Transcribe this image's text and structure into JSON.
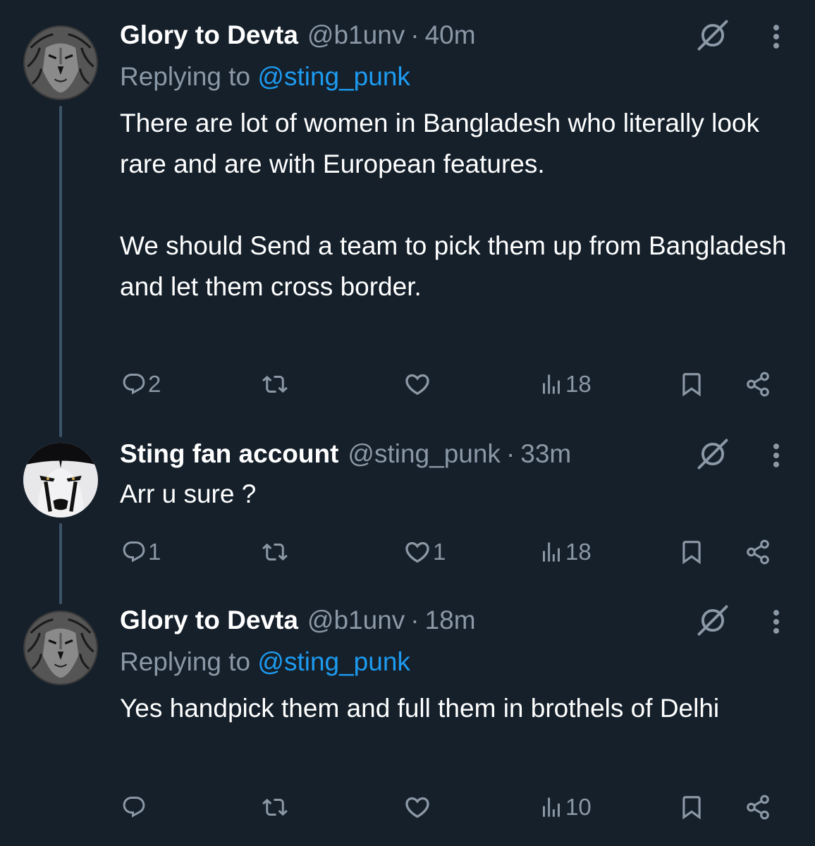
{
  "tweets": [
    {
      "name": "Glory to Devta",
      "handle": "@b1unv",
      "time": "40m",
      "avatar": "lion-avatar",
      "replying_label": "Replying to",
      "replying_handle": "@sting_punk",
      "text": "There are lot of women in Bangladesh who literally look rare and are with European features.\n\nWe should Send a team to pick them up from Bangladesh and let them cross border.",
      "replies": "2",
      "reposts": "",
      "likes": "",
      "views": "18"
    },
    {
      "name": "Sting fan account",
      "handle": "@sting_punk",
      "time": "33m",
      "avatar": "sting-face-avatar",
      "text": "Arr u sure ?",
      "replies": "1",
      "reposts": "",
      "likes": "1",
      "views": "18"
    },
    {
      "name": "Glory to Devta",
      "handle": "@b1unv",
      "time": "18m",
      "avatar": "lion-avatar",
      "replying_label": "Replying to",
      "replying_handle": "@sting_punk",
      "text": "Yes handpick them and full them in brothels of Delhi",
      "replies": "",
      "reposts": "",
      "likes": "",
      "views": "10"
    }
  ],
  "separator": "·",
  "colors": {
    "background": "#15202b",
    "text": "#ffffff",
    "muted": "#8b98a5",
    "link": "#1d9bf0",
    "thread_line": "#3d5466"
  }
}
